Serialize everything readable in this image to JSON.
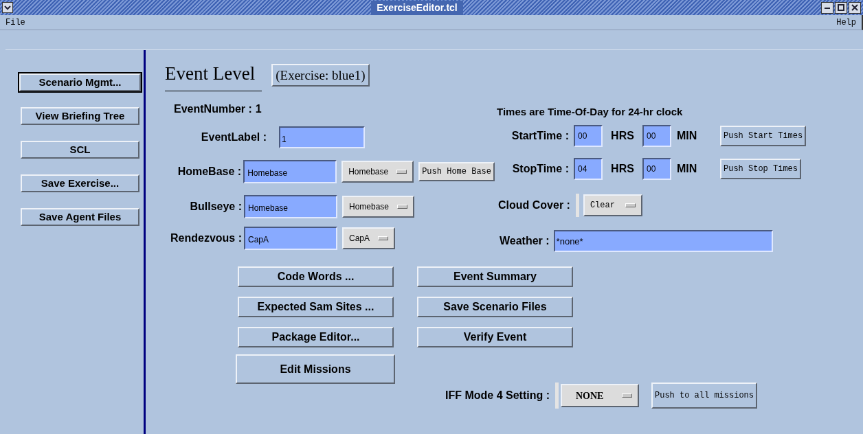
{
  "window": {
    "title": "ExerciseEditor.tcl"
  },
  "menu": [
    "File",
    "Help"
  ],
  "sidebar": {
    "buttons": [
      {
        "label": "Scenario Mgmt...",
        "focused": true
      },
      {
        "label": "View Briefing Tree",
        "focused": false
      },
      {
        "label": "SCL",
        "focused": false
      },
      {
        "label": "Save Exercise...",
        "focused": false
      },
      {
        "label": "Save Agent Files",
        "focused": false
      }
    ]
  },
  "header": {
    "title": "Event Level",
    "exercise_button": "(Exercise: blue1)"
  },
  "event_number": {
    "label": "EventNumber :",
    "value": "1"
  },
  "event_label": {
    "label": "EventLabel :",
    "value": "1"
  },
  "locations": [
    {
      "label": "HomeBase :",
      "value": "Homebase",
      "choice": "Homebase",
      "push_button": "Push Home Base"
    },
    {
      "label": "Bullseye :",
      "value": "Homebase",
      "choice": "Homebase"
    },
    {
      "label": "Rendezvous :",
      "value": "CapA",
      "choice": "CapA"
    }
  ],
  "times": {
    "note": "Times are Time-Of-Day for 24-hr clock",
    "rows": [
      {
        "label": "StartTime :",
        "hours": "00",
        "hours_unit": "HRS",
        "minutes": "00",
        "minutes_unit": "MIN",
        "push_button": "Push Start Times"
      },
      {
        "label": "StopTime :",
        "hours": "04",
        "hours_unit": "HRS",
        "minutes": "00",
        "minutes_unit": "MIN",
        "push_button": "Push Stop Times"
      }
    ]
  },
  "cloud_cover": {
    "label": "Cloud Cover :",
    "choice": "Clear"
  },
  "weather": {
    "label": "Weather :",
    "value": "*none*"
  },
  "action_buttons": {
    "left": [
      {
        "label": "Code Words ...",
        "kind": "normal"
      },
      {
        "label": "Expected Sam Sites ...",
        "kind": "normal"
      },
      {
        "label": "Package Editor...",
        "kind": "normal"
      },
      {
        "label": "Edit Missions",
        "kind": "large"
      }
    ],
    "right": [
      {
        "label": "Event Summary",
        "kind": "normal"
      },
      {
        "label": "Save Scenario Files",
        "kind": "normal"
      },
      {
        "label": "Verify Event",
        "kind": "normal"
      }
    ]
  },
  "iff": {
    "label": "IFF Mode 4 Setting :",
    "choice": "NONE",
    "push_button": "Push to all missions"
  }
}
